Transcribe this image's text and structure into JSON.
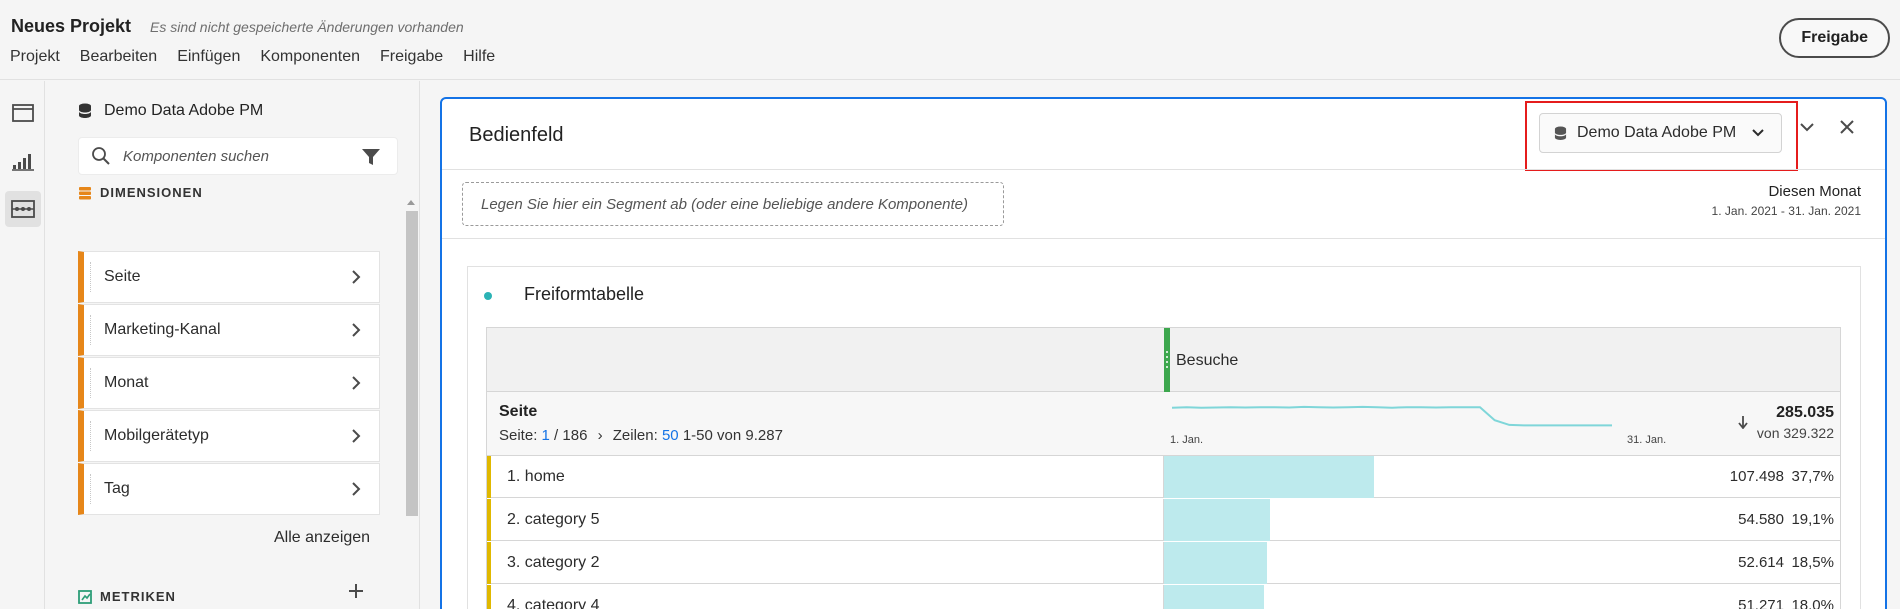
{
  "header": {
    "project_title": "Neues Projekt",
    "unsaved_notice": "Es sind nicht gespeicherte Änderungen vorhanden",
    "share_label": "Freigabe",
    "menu": [
      "Projekt",
      "Bearbeiten",
      "Einfügen",
      "Komponenten",
      "Freigabe",
      "Hilfe"
    ]
  },
  "rail": {
    "icons": [
      "panel-icon",
      "visualizations-icon",
      "components-icon"
    ],
    "active": "components-icon"
  },
  "components": {
    "data_source": "Demo Data Adobe PM",
    "search_placeholder": "Komponenten suchen",
    "dimensions_title": "DIMENSIONEN",
    "dimensions": [
      "Seite",
      "Marketing-Kanal",
      "Monat",
      "Mobilgerätetyp",
      "Tag"
    ],
    "show_all": "Alle anzeigen",
    "metrics_title": "METRIKEN"
  },
  "panel": {
    "title": "Bedienfeld",
    "report_suite": "Demo Data Adobe PM",
    "dropzone_text": "Legen Sie hier ein Segment ab (oder eine beliebige andere Komponente)",
    "date_label": "Diesen Monat",
    "date_range": "1. Jan. 2021 - 31. Jan. 2021"
  },
  "table": {
    "title": "Freiformtabelle",
    "metric": "Besuche",
    "dimension": "Seite",
    "pager": {
      "page_label": "Seite:",
      "page": "1",
      "page_total": "/ 186",
      "rows_label": "Zeilen:",
      "rows": "50",
      "range": "1-50 von 9.287"
    },
    "spark_start": "1. Jan.",
    "spark_end": "31. Jan.",
    "spark_values": [
      0.78,
      0.8,
      0.78,
      0.79,
      0.8,
      0.79,
      0.8,
      0.8,
      0.79,
      0.81,
      0.8,
      0.79,
      0.8,
      0.81,
      0.8,
      0.78,
      0.8,
      0.8,
      0.79,
      0.8,
      0.8,
      0.8,
      0.3,
      0.12,
      0.1,
      0.1,
      0.1,
      0.1,
      0.1,
      0.1,
      0.1
    ],
    "total": "285.035",
    "total_of": "von 329.322",
    "max_share": 0.377,
    "rows": [
      {
        "label": "1. home",
        "value": "107.498",
        "pct": "37,7%",
        "share": 0.377
      },
      {
        "label": "2. category 5",
        "value": "54.580",
        "pct": "19,1%",
        "share": 0.191
      },
      {
        "label": "3. category 2",
        "value": "52.614",
        "pct": "18,5%",
        "share": 0.185
      },
      {
        "label": "4. category 4",
        "value": "51.271",
        "pct": "18,0%",
        "share": 0.18
      }
    ]
  }
}
